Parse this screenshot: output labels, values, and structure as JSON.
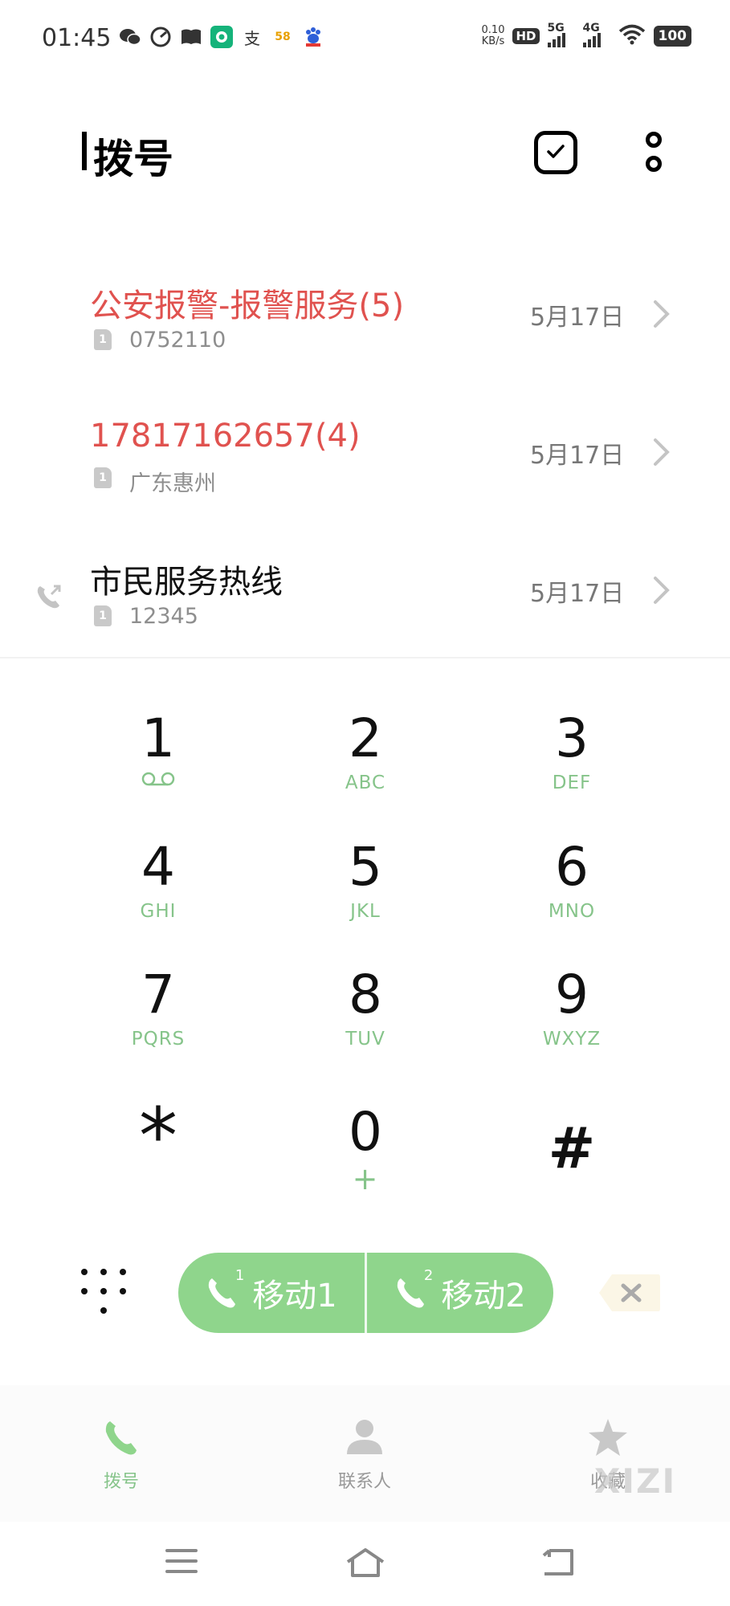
{
  "status_bar": {
    "time": "01:45",
    "net_speed_value": "0.10",
    "net_speed_unit": "KB/s",
    "hd_label": "HD",
    "sim1_network": "5G",
    "sim2_network": "4G",
    "battery": "100",
    "app_icons": [
      "wechat-icon",
      "speedometer-icon",
      "book-icon",
      "green-app-icon",
      "alipay-icon",
      "58-app-icon",
      "baidu-icon"
    ],
    "alipay_glyph": "支",
    "app58_glyph": "58"
  },
  "header": {
    "title": "拨号"
  },
  "call_log": [
    {
      "name": "公安报警-报警服务(5)",
      "sub": "0752110",
      "date": "5月17日",
      "missed": true,
      "sim": "1"
    },
    {
      "name": "17817162657(4)",
      "sub": "广东惠州",
      "date": "5月17日",
      "missed": true,
      "sim": "1"
    },
    {
      "name": "市民服务热线",
      "sub": "12345",
      "date": "5月17日",
      "missed": false,
      "sim": "1"
    }
  ],
  "keypad": {
    "keys": [
      {
        "digit": "1",
        "letters": ""
      },
      {
        "digit": "2",
        "letters": "ABC"
      },
      {
        "digit": "3",
        "letters": "DEF"
      },
      {
        "digit": "4",
        "letters": "GHI"
      },
      {
        "digit": "5",
        "letters": "JKL"
      },
      {
        "digit": "6",
        "letters": "MNO"
      },
      {
        "digit": "7",
        "letters": "PQRS"
      },
      {
        "digit": "8",
        "letters": "TUV"
      },
      {
        "digit": "9",
        "letters": "WXYZ"
      },
      {
        "digit": "*",
        "letters": ""
      },
      {
        "digit": "0",
        "letters": "+"
      },
      {
        "digit": "#",
        "letters": ""
      }
    ]
  },
  "dial": {
    "sim1_label": "移动1",
    "sim2_label": "移动2",
    "sim1_index": "1",
    "sim2_index": "2"
  },
  "bottom_nav": {
    "items": [
      {
        "label": "拨号",
        "active": true
      },
      {
        "label": "联系人",
        "active": false
      },
      {
        "label": "收藏",
        "active": false
      }
    ]
  },
  "watermark": "XIZI",
  "colors": {
    "accent_green": "#8fd58c",
    "letters_green": "#86c48a",
    "missed_red": "#e0524f",
    "text_dark": "#111111",
    "text_gray": "#8e8e8e"
  }
}
